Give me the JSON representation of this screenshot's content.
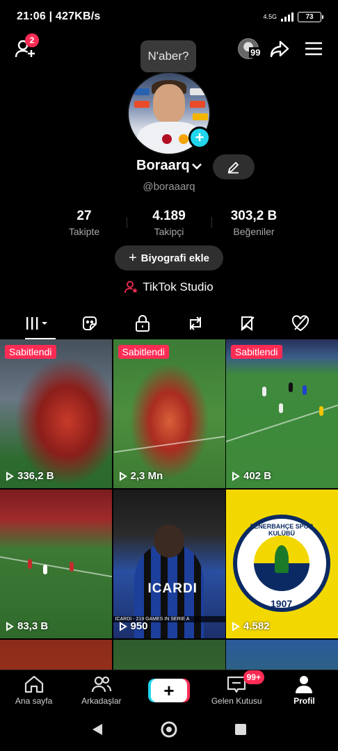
{
  "status_bar": {
    "time": "21:06",
    "speed": "427KB/s",
    "network": "4.5G",
    "battery": "73"
  },
  "header": {
    "friend_badge": "2",
    "story_count": "99"
  },
  "profile": {
    "tooltip": "N'aber?",
    "display_name": "Boraarq",
    "handle": "@boraaarq",
    "stats": [
      {
        "value": "27",
        "label": "Takipte"
      },
      {
        "value": "4.189",
        "label": "Takipçi"
      },
      {
        "value": "303,2 B",
        "label": "Beğeniler"
      }
    ],
    "bio_button": "Biyografi ekle",
    "studio_link": "TikTok Studio"
  },
  "videos": [
    {
      "pinned": "Sabitlendi",
      "views": "336,2 B"
    },
    {
      "pinned": "Sabitlendi",
      "views": "2,3 Mn"
    },
    {
      "pinned": "Sabitlendi",
      "views": "402 B"
    },
    {
      "views": "83,3 B"
    },
    {
      "views": "950",
      "overlay": "ICARDI",
      "caption": "ICARDI - 219 GAMES IN SERIE A"
    },
    {
      "views": "4.582",
      "overlay": "FENERBAHÇE SPOR KULÜBÜ",
      "year": "1907"
    }
  ],
  "bottom_nav": [
    {
      "label": "Ana sayfa"
    },
    {
      "label": "Arkadaşlar"
    },
    {
      "label": ""
    },
    {
      "label": "Gelen Kutusu",
      "badge": "99+"
    },
    {
      "label": "Profil"
    }
  ]
}
